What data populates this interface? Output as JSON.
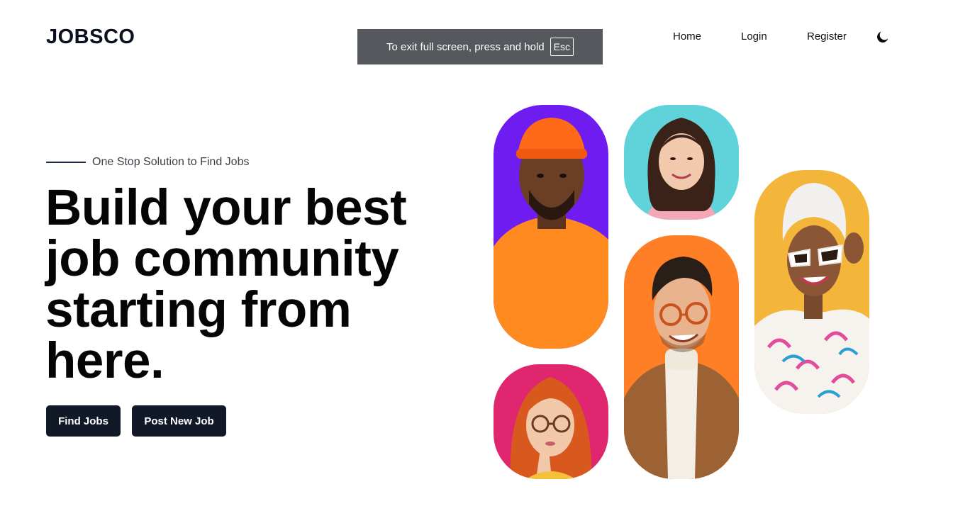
{
  "header": {
    "logo": "JOBSCO",
    "nav": [
      {
        "label": "Home"
      },
      {
        "label": "Login"
      },
      {
        "label": "Register"
      }
    ],
    "theme_toggle_icon": "moon-icon"
  },
  "fullscreen_notice": {
    "text": "To exit full screen, press and hold",
    "key": "Esc"
  },
  "hero": {
    "tagline": "One Stop Solution to Find Jobs",
    "headline_lines": [
      "Build your best",
      "job community",
      "starting from",
      "here."
    ],
    "buttons": {
      "find_jobs": "Find Jobs",
      "post_new_job": "Post New Job"
    }
  },
  "gallery": {
    "colors": {
      "purple": "#6f1cf0",
      "cyan": "#5fd3d9",
      "yellow": "#f3b63a",
      "orange": "#ff7f27",
      "pink": "#e0266e"
    },
    "portraits": [
      {
        "name": "portrait-man-orange-beanie",
        "bg": "#6f1cf0"
      },
      {
        "name": "portrait-woman-smiling",
        "bg": "#5fd3d9"
      },
      {
        "name": "portrait-woman-sunglasses",
        "bg": "#f3b63a"
      },
      {
        "name": "portrait-man-glasses",
        "bg": "#ff7f27"
      },
      {
        "name": "portrait-woman-thinking",
        "bg": "#e0266e"
      }
    ]
  }
}
